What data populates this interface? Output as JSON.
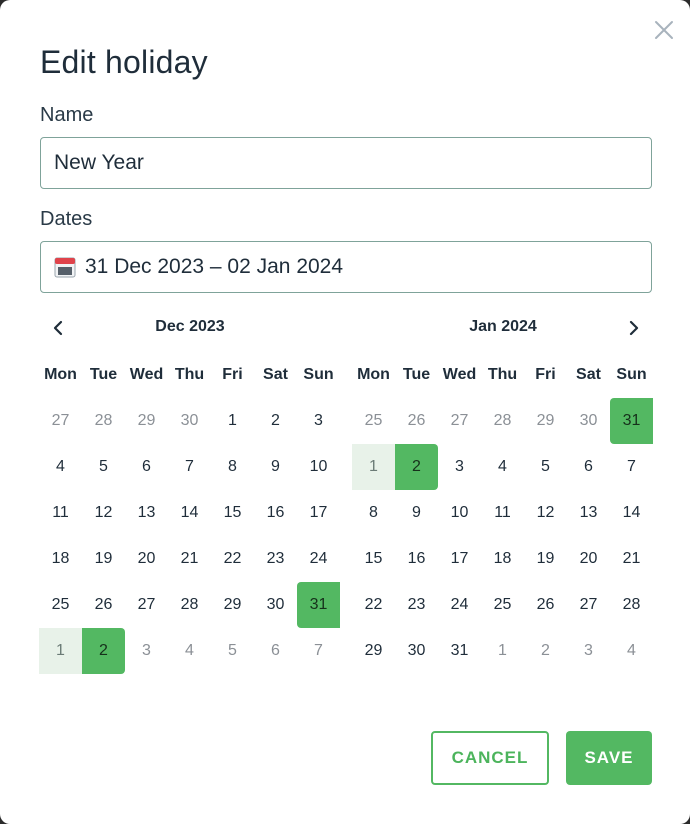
{
  "dialog": {
    "title": "Edit holiday",
    "close_icon": "close-icon",
    "name_label": "Name",
    "name_value": "New Year",
    "dates_label": "Dates",
    "dates_value": "31 Dec 2023 – 02 Jan 2024",
    "calendar_icon": "calendar-icon",
    "cancel_label": "CANCEL",
    "save_label": "SAVE",
    "accent_color": "#53b862"
  },
  "calendar": {
    "prev_icon": "chevron-left-icon",
    "next_icon": "chevron-right-icon",
    "weekdays": [
      "Mon",
      "Tue",
      "Wed",
      "Thu",
      "Fri",
      "Sat",
      "Sun"
    ],
    "months": [
      {
        "title": "Dec 2023",
        "days": [
          {
            "d": "27",
            "s": "muted"
          },
          {
            "d": "28",
            "s": "muted"
          },
          {
            "d": "29",
            "s": "muted"
          },
          {
            "d": "30",
            "s": "muted"
          },
          {
            "d": "1",
            "s": ""
          },
          {
            "d": "2",
            "s": ""
          },
          {
            "d": "3",
            "s": ""
          },
          {
            "d": "4",
            "s": ""
          },
          {
            "d": "5",
            "s": ""
          },
          {
            "d": "6",
            "s": ""
          },
          {
            "d": "7",
            "s": ""
          },
          {
            "d": "8",
            "s": ""
          },
          {
            "d": "9",
            "s": ""
          },
          {
            "d": "10",
            "s": ""
          },
          {
            "d": "11",
            "s": ""
          },
          {
            "d": "12",
            "s": ""
          },
          {
            "d": "13",
            "s": ""
          },
          {
            "d": "14",
            "s": ""
          },
          {
            "d": "15",
            "s": ""
          },
          {
            "d": "16",
            "s": ""
          },
          {
            "d": "17",
            "s": ""
          },
          {
            "d": "18",
            "s": ""
          },
          {
            "d": "19",
            "s": ""
          },
          {
            "d": "20",
            "s": ""
          },
          {
            "d": "21",
            "s": ""
          },
          {
            "d": "22",
            "s": ""
          },
          {
            "d": "23",
            "s": ""
          },
          {
            "d": "24",
            "s": ""
          },
          {
            "d": "25",
            "s": ""
          },
          {
            "d": "26",
            "s": ""
          },
          {
            "d": "27",
            "s": ""
          },
          {
            "d": "28",
            "s": ""
          },
          {
            "d": "29",
            "s": ""
          },
          {
            "d": "30",
            "s": ""
          },
          {
            "d": "31",
            "s": "start"
          },
          {
            "d": "1",
            "s": "range-muted"
          },
          {
            "d": "2",
            "s": "end"
          },
          {
            "d": "3",
            "s": "muted"
          },
          {
            "d": "4",
            "s": "muted"
          },
          {
            "d": "5",
            "s": "muted"
          },
          {
            "d": "6",
            "s": "muted"
          },
          {
            "d": "7",
            "s": "muted"
          }
        ]
      },
      {
        "title": "Jan 2024",
        "days": [
          {
            "d": "25",
            "s": "muted"
          },
          {
            "d": "26",
            "s": "muted"
          },
          {
            "d": "27",
            "s": "muted"
          },
          {
            "d": "28",
            "s": "muted"
          },
          {
            "d": "29",
            "s": "muted"
          },
          {
            "d": "30",
            "s": "muted"
          },
          {
            "d": "31",
            "s": "start"
          },
          {
            "d": "1",
            "s": "range"
          },
          {
            "d": "2",
            "s": "end"
          },
          {
            "d": "3",
            "s": ""
          },
          {
            "d": "4",
            "s": ""
          },
          {
            "d": "5",
            "s": ""
          },
          {
            "d": "6",
            "s": ""
          },
          {
            "d": "7",
            "s": ""
          },
          {
            "d": "8",
            "s": ""
          },
          {
            "d": "9",
            "s": ""
          },
          {
            "d": "10",
            "s": ""
          },
          {
            "d": "11",
            "s": ""
          },
          {
            "d": "12",
            "s": ""
          },
          {
            "d": "13",
            "s": ""
          },
          {
            "d": "14",
            "s": ""
          },
          {
            "d": "15",
            "s": ""
          },
          {
            "d": "16",
            "s": ""
          },
          {
            "d": "17",
            "s": ""
          },
          {
            "d": "18",
            "s": ""
          },
          {
            "d": "19",
            "s": ""
          },
          {
            "d": "20",
            "s": ""
          },
          {
            "d": "21",
            "s": ""
          },
          {
            "d": "22",
            "s": ""
          },
          {
            "d": "23",
            "s": ""
          },
          {
            "d": "24",
            "s": ""
          },
          {
            "d": "25",
            "s": ""
          },
          {
            "d": "26",
            "s": ""
          },
          {
            "d": "27",
            "s": ""
          },
          {
            "d": "28",
            "s": ""
          },
          {
            "d": "29",
            "s": ""
          },
          {
            "d": "30",
            "s": ""
          },
          {
            "d": "31",
            "s": ""
          },
          {
            "d": "1",
            "s": "muted"
          },
          {
            "d": "2",
            "s": "muted"
          },
          {
            "d": "3",
            "s": "muted"
          },
          {
            "d": "4",
            "s": "muted"
          }
        ]
      }
    ]
  }
}
